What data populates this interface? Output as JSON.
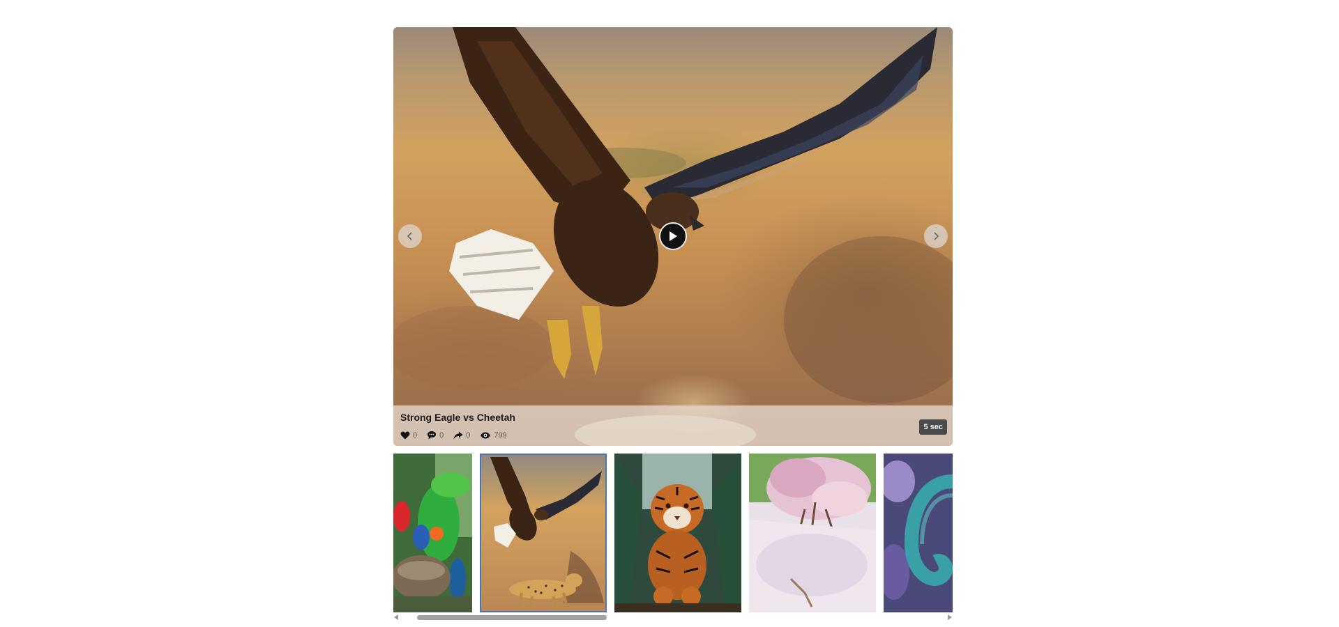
{
  "player": {
    "title": "Strong Eagle vs Cheetah",
    "duration": "5 sec",
    "stats": {
      "likes": "0",
      "comments": "0",
      "shares": "0",
      "views": "799"
    },
    "icons": {
      "like": "heart-icon",
      "comment": "comment-icon",
      "share": "share-icon",
      "views": "eye-icon",
      "play": "play-icon",
      "prev": "chevron-left-icon",
      "next": "chevron-right-icon"
    }
  },
  "thumbnails": [
    {
      "subject": "parrots",
      "active": false
    },
    {
      "subject": "eagle-and-cheetah",
      "active": true
    },
    {
      "subject": "tiger",
      "active": false
    },
    {
      "subject": "cherry-blossom-path",
      "active": false
    },
    {
      "subject": "chameleon",
      "active": false
    }
  ],
  "colors": {
    "active_border": "#4a74b8",
    "duration_badge": "#4a4a4a",
    "scrollbar_thumb": "#a0a0a0"
  }
}
